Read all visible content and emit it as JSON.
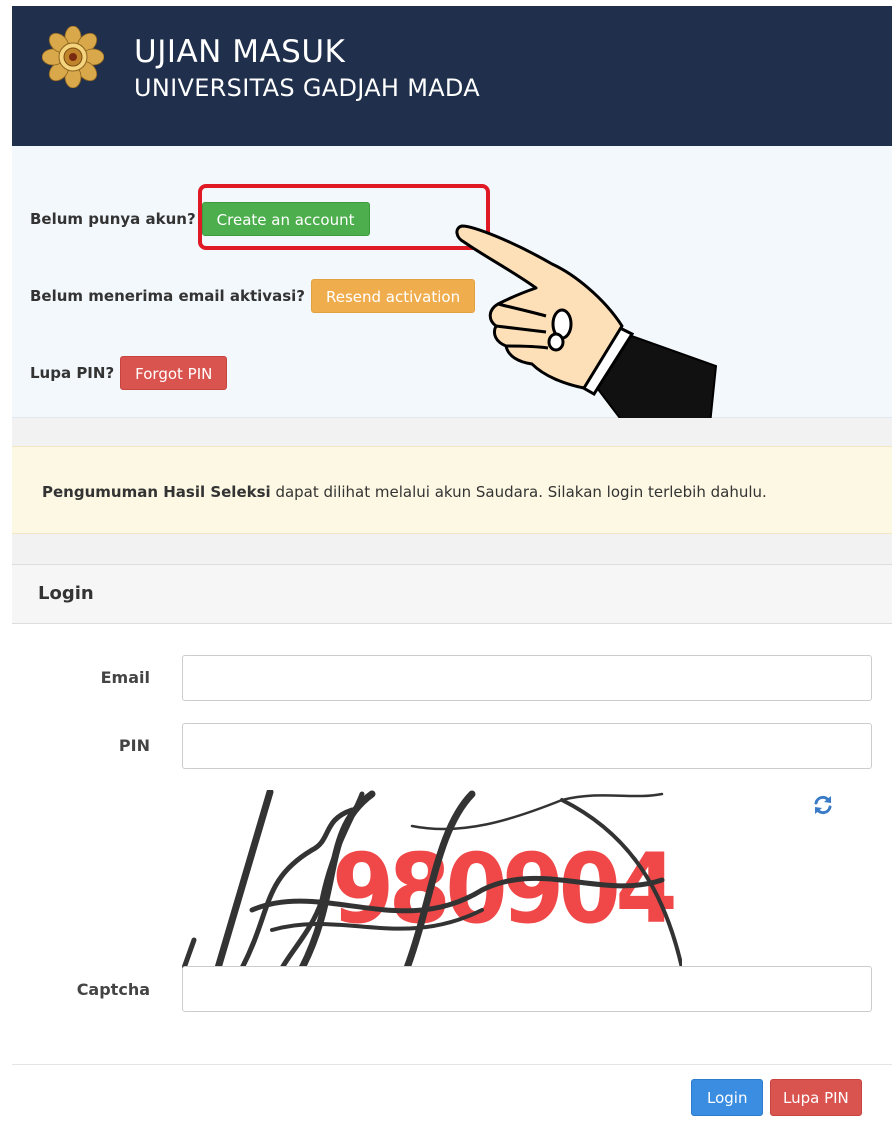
{
  "header": {
    "title_line1": "UJIAN MASUK",
    "title_line2": "UNIVERSITAS GADJAH MADA",
    "logo_icon": "ugm-seal-icon"
  },
  "actions": {
    "create_label": "Belum punya akun?",
    "create_button": "Create an account",
    "resend_label": "Belum menerima email aktivasi?",
    "resend_button": "Resend activation",
    "forgot_label": "Lupa PIN?",
    "forgot_button": "Forgot PIN"
  },
  "notice": {
    "bold": "Pengumuman Hasil Seleksi",
    "text": " dapat dilihat melalui akun Saudara. Silakan login terlebih dahulu."
  },
  "login": {
    "title": "Login",
    "email_label": "Email",
    "email_value": "",
    "pin_label": "PIN",
    "pin_value": "",
    "captcha_label": "Captcha",
    "captcha_value": "",
    "captcha_text": "980904",
    "refresh_icon": "refresh-icon",
    "login_button": "Login",
    "lupa_button": "Lupa PIN"
  },
  "colors": {
    "header_bg": "#1f2f4c",
    "green": "#4cae4c",
    "orange": "#f0ad4e",
    "red": "#d9534f",
    "blue": "#3a8de0",
    "highlight": "#e01a24",
    "captcha_text": "#f04848"
  }
}
